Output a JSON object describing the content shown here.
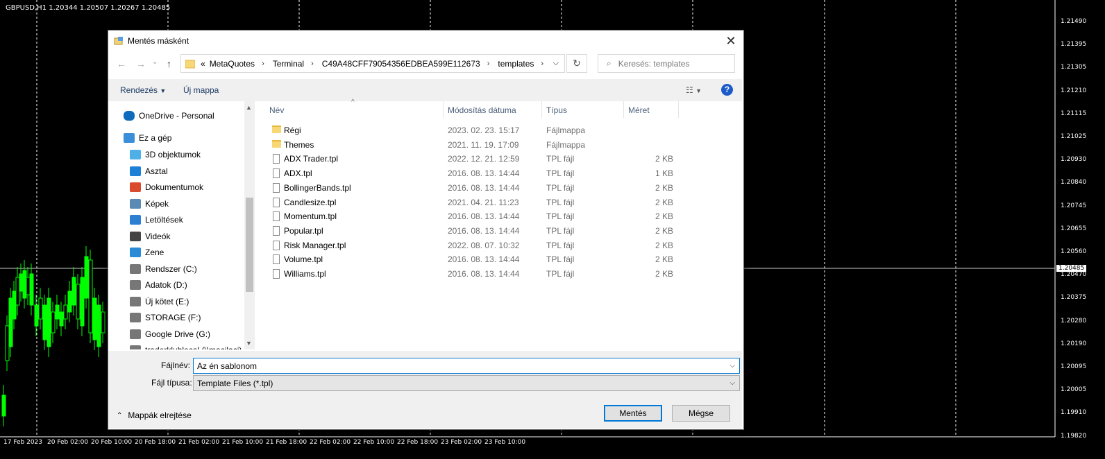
{
  "chart": {
    "title": "GBPUSD,H1  1.20344 1.20507 1.20267 1.20485",
    "current_price": "1.20485",
    "price_labels": [
      "1.21490",
      "1.21395",
      "1.21305",
      "1.21210",
      "1.21115",
      "1.21025",
      "1.20930",
      "1.20840",
      "1.20745",
      "1.20655",
      "1.20560",
      "1.20470",
      "1.20375",
      "1.20280",
      "1.20190",
      "1.20095",
      "1.20005",
      "1.19910",
      "1.19820"
    ],
    "time_labels": [
      "17 Feb 2023",
      "20 Feb 02:00",
      "20 Feb 10:00",
      "20 Feb 18:00",
      "21 Feb 02:00",
      "21 Feb 10:00",
      "21 Feb 18:00",
      "22 Feb 02:00",
      "22 Feb 10:00",
      "22 Feb 18:00",
      "23 Feb 02:00",
      "23 Feb 10:00"
    ],
    "colors": {
      "background": "#000000",
      "candle_up": "#00ff00",
      "candle_down": "#000000",
      "grid": "#ffffff"
    }
  },
  "dialog": {
    "title": "Mentés másként",
    "breadcrumb": [
      "«",
      "MetaQuotes",
      "Terminal",
      "C49A48CFF79054356EDBEA599E112673",
      "templates"
    ],
    "search_placeholder": "Keresés: templates",
    "toolbar": {
      "organize": "Rendezés",
      "new_folder": "Új mappa",
      "help": "?"
    },
    "nav": [
      {
        "label": "OneDrive - Personal",
        "icon": "cloud-icon"
      },
      {
        "label": "Ez a gép",
        "icon": "computer-icon"
      },
      {
        "label": "3D objektumok",
        "icon": "cube-icon"
      },
      {
        "label": "Asztal",
        "icon": "desktop-icon"
      },
      {
        "label": "Dokumentumok",
        "icon": "documents-icon"
      },
      {
        "label": "Képek",
        "icon": "pictures-icon"
      },
      {
        "label": "Letöltések",
        "icon": "download-icon"
      },
      {
        "label": "Videók",
        "icon": "video-icon"
      },
      {
        "label": "Zene",
        "icon": "music-icon"
      },
      {
        "label": "Rendszer (C:)",
        "icon": "drive-icon"
      },
      {
        "label": "Adatok (D:)",
        "icon": "drive-icon"
      },
      {
        "label": "Új kötet (E:)",
        "icon": "drive-icon"
      },
      {
        "label": "STORAGE (F:)",
        "icon": "drive-icon"
      },
      {
        "label": "Google Drive (G:)",
        "icon": "drive-icon"
      },
      {
        "label": "traderklublocal (\\\\macilaci)",
        "icon": "network-drive-icon"
      }
    ],
    "columns": {
      "name": "Név",
      "date": "Módosítás dátuma",
      "type": "Típus",
      "size": "Méret"
    },
    "files": [
      {
        "name": "Régi",
        "date": "2023. 02. 23. 15:17",
        "type": "Fájlmappa",
        "size": "",
        "kind": "folder"
      },
      {
        "name": "Themes",
        "date": "2021. 11. 19. 17:09",
        "type": "Fájlmappa",
        "size": "",
        "kind": "folder"
      },
      {
        "name": "ADX Trader.tpl",
        "date": "2022. 12. 21. 12:59",
        "type": "TPL fájl",
        "size": "2 KB",
        "kind": "file"
      },
      {
        "name": "ADX.tpl",
        "date": "2016. 08. 13. 14:44",
        "type": "TPL fájl",
        "size": "1 KB",
        "kind": "file"
      },
      {
        "name": "BollingerBands.tpl",
        "date": "2016. 08. 13. 14:44",
        "type": "TPL fájl",
        "size": "2 KB",
        "kind": "file"
      },
      {
        "name": "Candlesize.tpl",
        "date": "2021. 04. 21. 11:23",
        "type": "TPL fájl",
        "size": "2 KB",
        "kind": "file"
      },
      {
        "name": "Momentum.tpl",
        "date": "2016. 08. 13. 14:44",
        "type": "TPL fájl",
        "size": "2 KB",
        "kind": "file"
      },
      {
        "name": "Popular.tpl",
        "date": "2016. 08. 13. 14:44",
        "type": "TPL fájl",
        "size": "2 KB",
        "kind": "file"
      },
      {
        "name": "Risk Manager.tpl",
        "date": "2022. 08. 07. 10:32",
        "type": "TPL fájl",
        "size": "2 KB",
        "kind": "file"
      },
      {
        "name": "Volume.tpl",
        "date": "2016. 08. 13. 14:44",
        "type": "TPL fájl",
        "size": "2 KB",
        "kind": "file"
      },
      {
        "name": "Williams.tpl",
        "date": "2016. 08. 13. 14:44",
        "type": "TPL fájl",
        "size": "2 KB",
        "kind": "file"
      }
    ],
    "filename_label": "Fájlnév:",
    "filename_value": "Az én sablonom",
    "filetype_label": "Fájl típusa:",
    "filetype_value": "Template Files (*.tpl)",
    "hide_folders": "Mappák elrejtése",
    "save": "Mentés",
    "cancel": "Mégse"
  }
}
